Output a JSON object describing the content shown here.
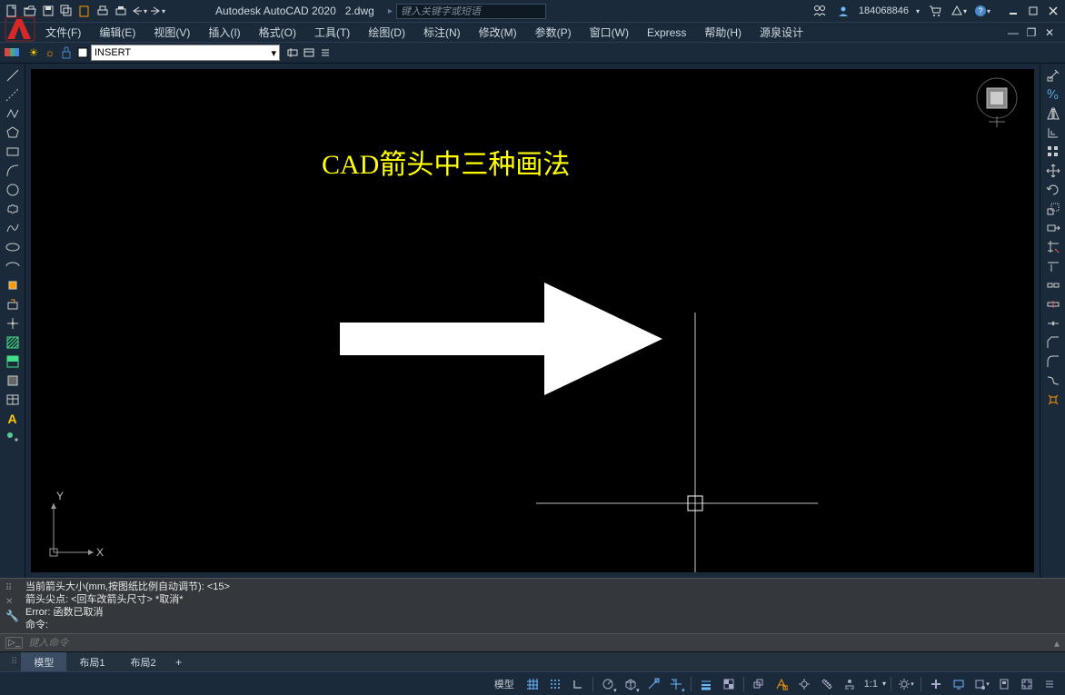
{
  "title": {
    "app": "Autodesk AutoCAD 2020",
    "file": "2.dwg"
  },
  "search": {
    "placeholder": "键入关键字或短语"
  },
  "user": {
    "id": "184068846"
  },
  "menu": [
    "文件(F)",
    "编辑(E)",
    "视图(V)",
    "插入(I)",
    "格式(O)",
    "工具(T)",
    "绘图(D)",
    "标注(N)",
    "修改(M)",
    "参数(P)",
    "窗口(W)",
    "Express",
    "帮助(H)",
    "源泉设计"
  ],
  "layer": {
    "name": "INSERT"
  },
  "canvas": {
    "title": "CAD箭头中三种画法",
    "ucs_y": "Y",
    "ucs_x": "X"
  },
  "cmd": {
    "line1": "当前箭头大小(mm,按图纸比例自动调节): <15>",
    "line2": "箭头尖点: <回车改箭头尺寸> *取消*",
    "line3": "Error: 函数已取消",
    "line4": "命令:",
    "placeholder": "键入命令"
  },
  "tabs": {
    "t1": "模型",
    "t2": "布局1",
    "t3": "布局2"
  },
  "status": {
    "model": "模型",
    "scale": "1:1"
  }
}
